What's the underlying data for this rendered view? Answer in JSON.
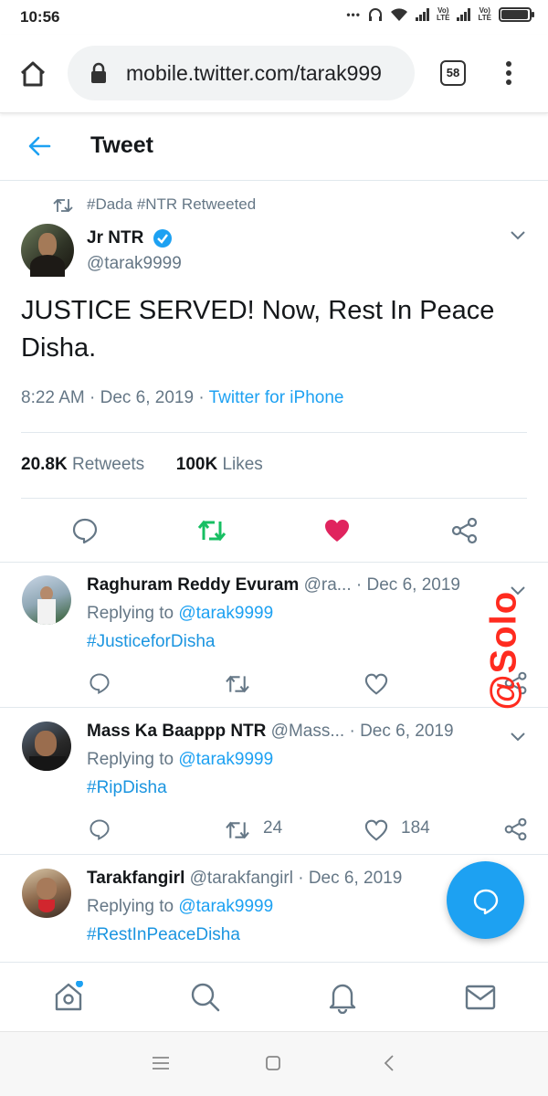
{
  "status_bar": {
    "time": "10:56",
    "lte_label": "Vo)\nLTE",
    "battery_level": 0.95
  },
  "browser": {
    "url": "mobile.twitter.com/tarak999",
    "tab_count": "58"
  },
  "header": {
    "title": "Tweet"
  },
  "tweet": {
    "retweeted_by": "#Dada #NTR Retweeted",
    "author_name": "Jr NTR",
    "author_handle": "@tarak9999",
    "text": "JUSTICE SERVED! Now, Rest In Peace Disha.",
    "time": "8:22 AM",
    "date": "Dec 6, 2019",
    "source": "Twitter for iPhone",
    "retweets_count": "20.8K",
    "retweets_label": "Retweets",
    "likes_count": "100K",
    "likes_label": "Likes"
  },
  "replies": [
    {
      "name": "Raghuram Reddy Evuram",
      "handle": "@ra...",
      "date": "Dec 6, 2019",
      "replying_prefix": "Replying to ",
      "replying_to": "@tarak9999",
      "text": "#JusticeforDisha",
      "retweets": "",
      "likes": ""
    },
    {
      "name": "Mass Ka Baappp NTR",
      "handle": "@Mass...",
      "date": "Dec 6, 2019",
      "replying_prefix": "Replying to ",
      "replying_to": "@tarak9999",
      "text": "#RipDisha",
      "retweets": "24",
      "likes": "184"
    },
    {
      "name": "Tarakfangirl",
      "handle": "@tarakfangirl",
      "date": "Dec 6, 2019",
      "replying_prefix": "Replying to ",
      "replying_to": "@tarak9999",
      "text": "#RestInPeaceDisha",
      "retweets": "",
      "likes": ""
    }
  ],
  "watermark": "@Solo",
  "colors": {
    "accent": "#1da1f2",
    "retweet_green": "#17bf63",
    "like_red": "#e0245e",
    "watermark": "#ff2b1f"
  }
}
